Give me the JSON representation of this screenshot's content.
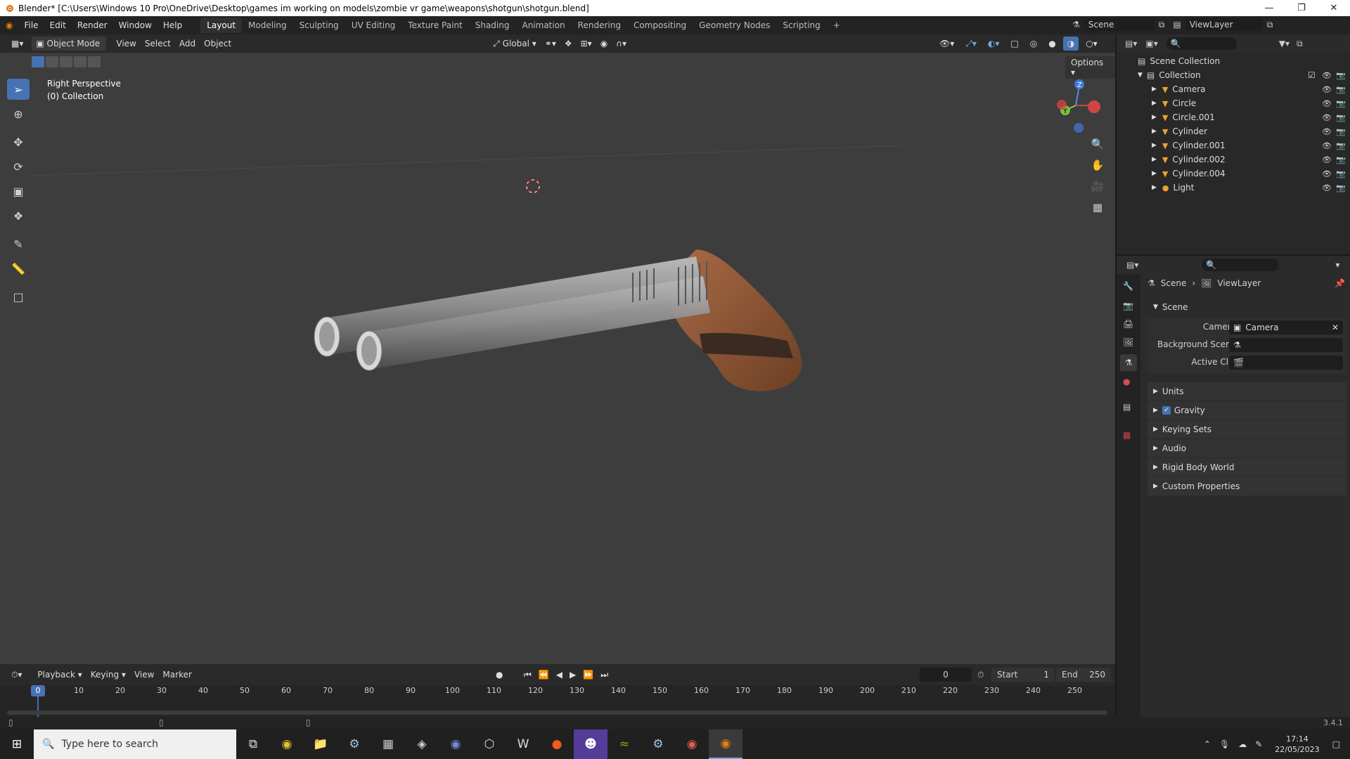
{
  "titlebar": {
    "text": "Blender* [C:\\Users\\Windows 10 Pro\\OneDrive\\Desktop\\games im working on models\\zombie vr game\\weapons\\shotgun\\shotgun.blend]"
  },
  "menu": [
    "File",
    "Edit",
    "Render",
    "Window",
    "Help"
  ],
  "workspaces": [
    "Layout",
    "Modeling",
    "Sculpting",
    "UV Editing",
    "Texture Paint",
    "Shading",
    "Animation",
    "Rendering",
    "Compositing",
    "Geometry Nodes",
    "Scripting"
  ],
  "top_right": {
    "scene": "Scene",
    "view_layer": "ViewLayer"
  },
  "viewport_header": {
    "mode": "Object Mode",
    "view": "View",
    "select": "Select",
    "add": "Add",
    "object": "Object",
    "orientation": "Global",
    "options": "Options"
  },
  "viewport": {
    "perspective": "Right Perspective",
    "collection": "(0) Collection"
  },
  "outliner": {
    "scene_collection": "Scene Collection",
    "collection": "Collection",
    "items": [
      "Camera",
      "Circle",
      "Circle.001",
      "Cylinder",
      "Cylinder.001",
      "Cylinder.002",
      "Cylinder.004",
      "Light"
    ]
  },
  "properties": {
    "breadcrumb_scene": "Scene",
    "breadcrumb_layer": "ViewLayer",
    "section_scene": "Scene",
    "camera_label": "Camera",
    "camera_value": "Camera",
    "background_scene_label": "Background Scene",
    "active_clip_label": "Active Clip",
    "sections": [
      "Units",
      "Gravity",
      "Keying Sets",
      "Audio",
      "Rigid Body World",
      "Custom Properties"
    ]
  },
  "timeline": {
    "playback": "Playback",
    "keying": "Keying",
    "view": "View",
    "marker": "Marker",
    "current_frame": "0",
    "start_label": "Start",
    "start": "1",
    "end_label": "End",
    "end": "250",
    "ticks": [
      "0",
      "10",
      "20",
      "30",
      "40",
      "50",
      "60",
      "70",
      "80",
      "90",
      "100",
      "110",
      "120",
      "130",
      "140",
      "150",
      "160",
      "170",
      "180",
      "190",
      "200",
      "210",
      "220",
      "230",
      "240",
      "250"
    ]
  },
  "status": {
    "version": "3.4.1"
  },
  "taskbar": {
    "search_placeholder": "Type here to search",
    "time": "17:14",
    "date": "22/05/2023"
  },
  "colors": {
    "accent": "#4772b3",
    "viewport_bg": "#3d3d3d"
  }
}
